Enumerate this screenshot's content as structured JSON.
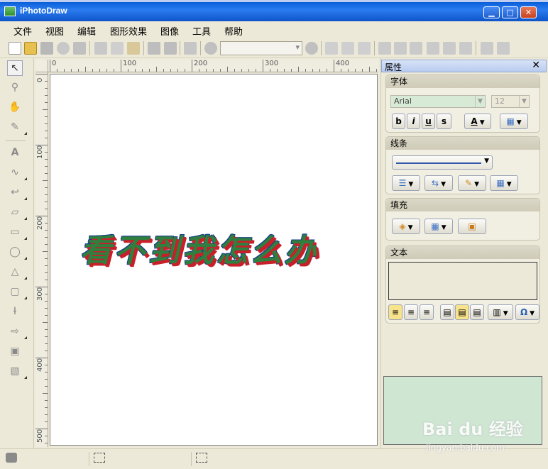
{
  "window": {
    "title": "iPhotoDraw",
    "min_label": "▁",
    "max_label": "□",
    "close_label": "✕"
  },
  "menu": [
    "文件",
    "视图",
    "编辑",
    "图形效果",
    "图像",
    "工具",
    "帮助"
  ],
  "ruler": {
    "horizontal": [
      "0",
      "100",
      "200",
      "300",
      "400"
    ],
    "vertical": [
      "0",
      "100",
      "200",
      "300",
      "400",
      "500"
    ]
  },
  "canvas": {
    "wordart_text": "看不到我怎么办"
  },
  "properties": {
    "title": "属性",
    "close": "✕",
    "font": {
      "title": "字体",
      "family": "Arial",
      "size": "12",
      "bold": "b",
      "italic": "i",
      "underline": "u",
      "strike": "s",
      "color_btn": "A"
    },
    "line": {
      "title": "线条"
    },
    "fill": {
      "title": "填充"
    },
    "text": {
      "title": "文本",
      "value": ""
    },
    "special_char": "Ω"
  },
  "watermark": {
    "brand": "Bai du 经验",
    "url": "jingyan.baidu.com"
  },
  "colors": {
    "title_bar": "#0a5fd8",
    "canvas": "#ffffff",
    "wordart_fill": "#2f7f3f",
    "wordart_shadow": "#c8202a",
    "preview_bg": "#cfe6d3"
  }
}
